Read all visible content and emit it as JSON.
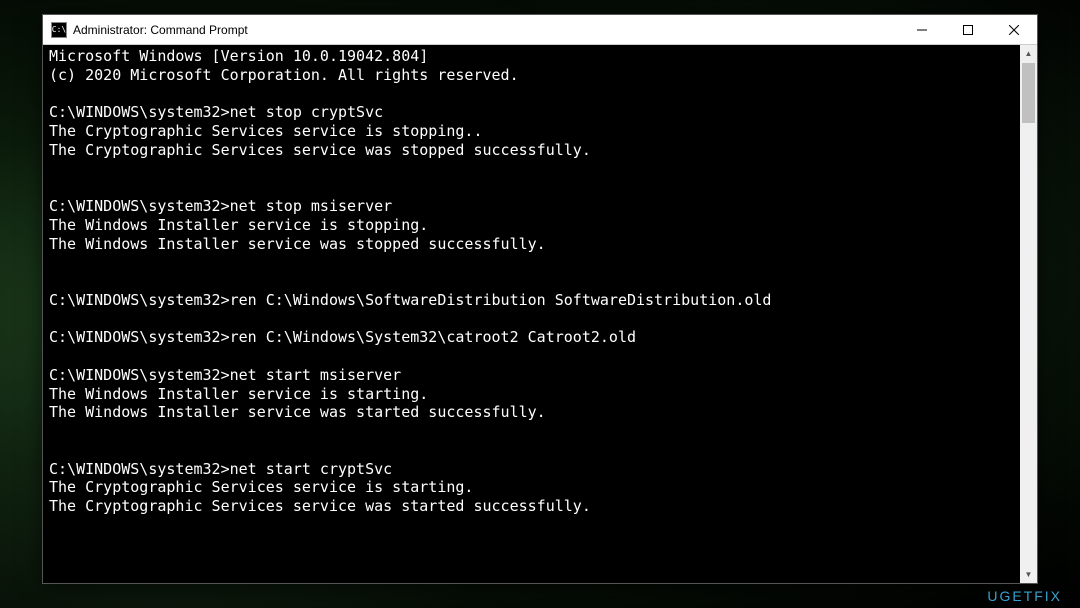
{
  "window": {
    "title": "Administrator: Command Prompt",
    "icon_label": "C:\\"
  },
  "terminal": {
    "lines": [
      "Microsoft Windows [Version 10.0.19042.804]",
      "(c) 2020 Microsoft Corporation. All rights reserved.",
      "",
      "C:\\WINDOWS\\system32>net stop cryptSvc",
      "The Cryptographic Services service is stopping..",
      "The Cryptographic Services service was stopped successfully.",
      "",
      "",
      "C:\\WINDOWS\\system32>net stop msiserver",
      "The Windows Installer service is stopping.",
      "The Windows Installer service was stopped successfully.",
      "",
      "",
      "C:\\WINDOWS\\system32>ren C:\\Windows\\SoftwareDistribution SoftwareDistribution.old",
      "",
      "C:\\WINDOWS\\system32>ren C:\\Windows\\System32\\catroot2 Catroot2.old",
      "",
      "C:\\WINDOWS\\system32>net start msiserver",
      "The Windows Installer service is starting.",
      "The Windows Installer service was started successfully.",
      "",
      "",
      "C:\\WINDOWS\\system32>net start cryptSvc",
      "The Cryptographic Services service is starting.",
      "The Cryptographic Services service was started successfully.",
      "",
      ""
    ]
  },
  "watermark": "UGETFIX"
}
